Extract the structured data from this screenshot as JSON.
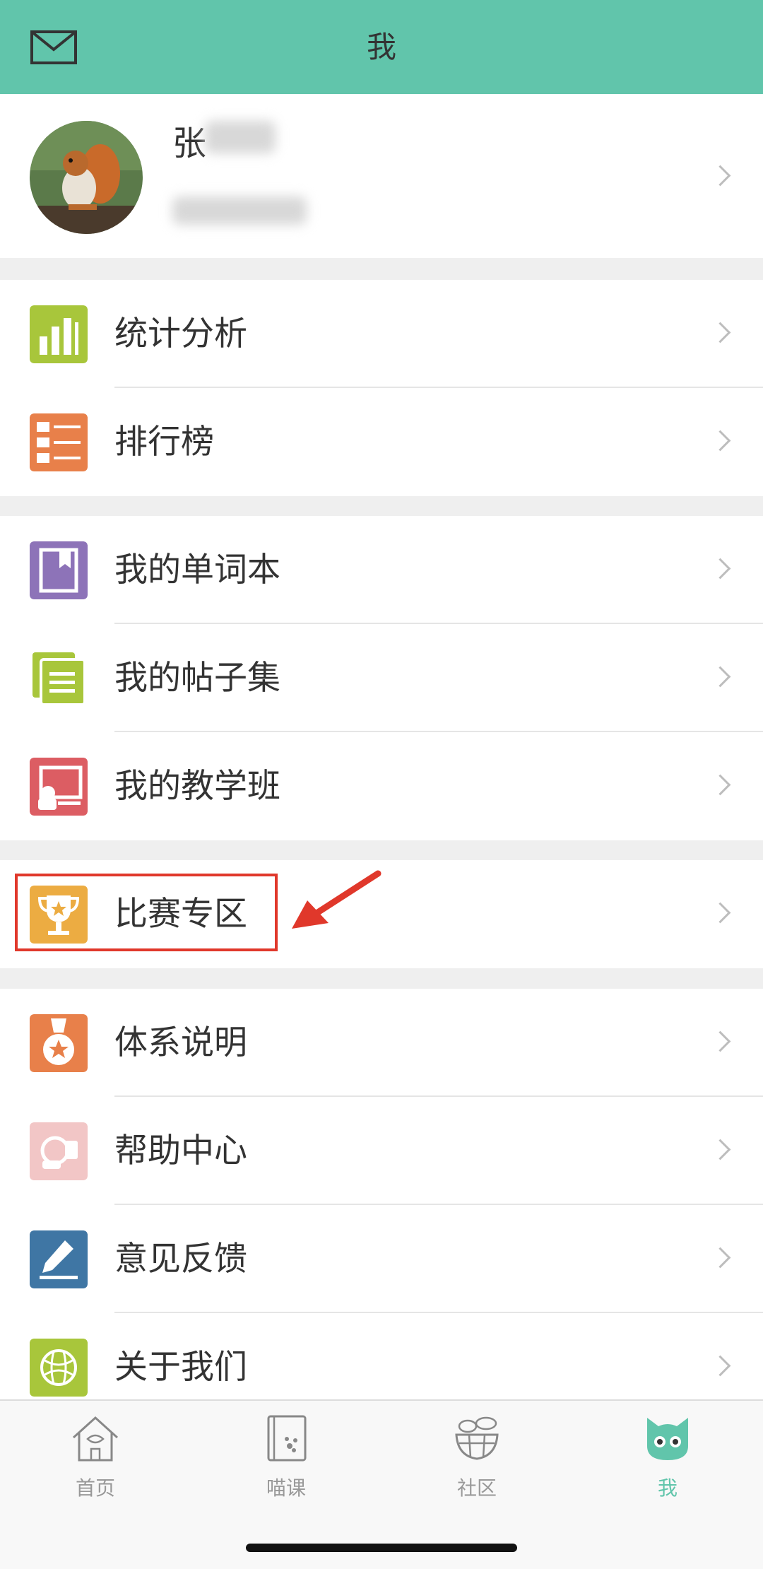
{
  "header": {
    "title": "我",
    "mail_icon": "mail-icon"
  },
  "profile": {
    "name": "张",
    "avatar_icon": "squirrel-avatar"
  },
  "groups": [
    {
      "items": [
        {
          "label": "统计分析",
          "icon": "bar-chart-icon",
          "color": "#a8c63b"
        },
        {
          "label": "排行榜",
          "icon": "ranking-list-icon",
          "color": "#e8804a"
        }
      ]
    },
    {
      "items": [
        {
          "label": "我的单词本",
          "icon": "notebook-icon",
          "color": "#8d73b8"
        },
        {
          "label": "我的帖子集",
          "icon": "posts-icon",
          "color": "#a8c63b"
        },
        {
          "label": "我的教学班",
          "icon": "class-icon",
          "color": "#dc5d63"
        }
      ]
    },
    {
      "items": [
        {
          "label": "比赛专区",
          "icon": "trophy-icon",
          "color": "#ecac42"
        }
      ]
    },
    {
      "items": [
        {
          "label": "体系说明",
          "icon": "medal-icon",
          "color": "#e8804a"
        },
        {
          "label": "帮助中心",
          "icon": "help-icon",
          "color": "#f2c6c6"
        },
        {
          "label": "意见反馈",
          "icon": "pencil-icon",
          "color": "#3f76a4"
        },
        {
          "label": "关于我们",
          "icon": "globe-icon",
          "color": "#a8c63b"
        }
      ]
    }
  ],
  "tabbar": {
    "tabs": [
      {
        "label": "首页",
        "icon": "home-icon"
      },
      {
        "label": "喵课",
        "icon": "course-book-icon"
      },
      {
        "label": "社区",
        "icon": "community-basket-icon"
      },
      {
        "label": "我",
        "icon": "cat-face-icon",
        "active": true
      }
    ],
    "active_color": "#61c5ab"
  },
  "colors": {
    "header_bg": "#61c5ab",
    "highlight": "#e0382b"
  }
}
